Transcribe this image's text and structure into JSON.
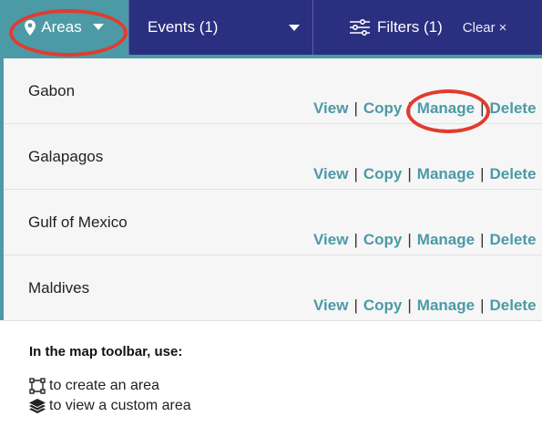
{
  "toolbar": {
    "areas_label": "Areas",
    "events_label": "Events (1)",
    "filters_label": "Filters (1)",
    "clear_label": "Clear",
    "clear_x": "×"
  },
  "areas": [
    {
      "name": "Gabon"
    },
    {
      "name": "Galapagos"
    },
    {
      "name": "Gulf of Mexico"
    },
    {
      "name": "Maldives"
    }
  ],
  "actions": {
    "view": "View",
    "copy": "Copy",
    "manage": "Manage",
    "delete": "Delete",
    "separator": "|"
  },
  "hint": {
    "title": "In the map toolbar, use:",
    "create": "to create an area",
    "custom": "to view a custom area"
  },
  "colors": {
    "toolbar": "#2b2f80",
    "accent": "#4c9aa6",
    "highlight": "#e23b2e"
  },
  "icons": {
    "pin": "map-pin-icon",
    "caret": "caret-down-icon",
    "filters": "sliders-icon",
    "polygon": "polygon-draw-icon",
    "layers": "layers-icon"
  }
}
